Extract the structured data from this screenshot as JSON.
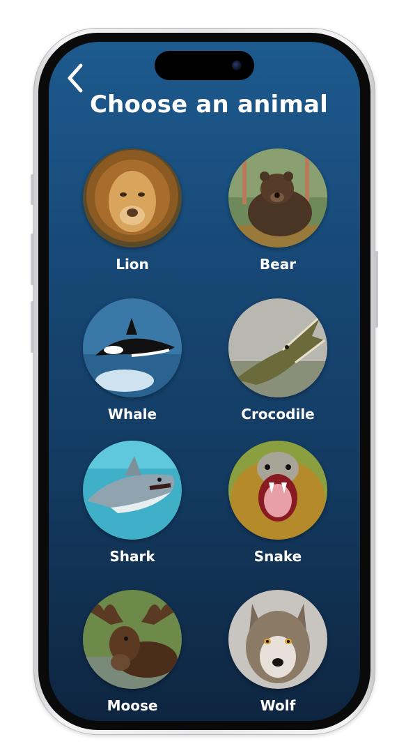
{
  "screen": {
    "title": "Choose an animal",
    "back_icon": "chevron-left-icon"
  },
  "animals": [
    {
      "label": "Lion"
    },
    {
      "label": "Bear"
    },
    {
      "label": "Whale"
    },
    {
      "label": "Crocodile"
    },
    {
      "label": "Shark"
    },
    {
      "label": "Snake"
    },
    {
      "label": "Moose"
    },
    {
      "label": "Wolf"
    }
  ],
  "colors": {
    "background_top": "#1d5a8e",
    "background_bottom": "#0e2540",
    "text": "#ffffff"
  }
}
